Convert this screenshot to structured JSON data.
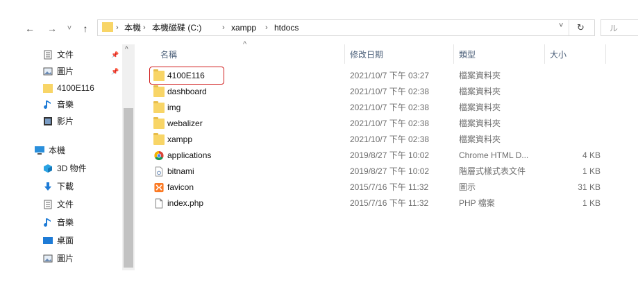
{
  "nav": {
    "back_glyph": "←",
    "forward_glyph": "→",
    "recent_glyph": "˅",
    "up_glyph": "↑",
    "dropdown_glyph": "˅",
    "refresh_glyph": "↻",
    "search_glyph": "ル"
  },
  "breadcrumb": [
    "本機",
    "本機磁碟 (C:)",
    "xampp",
    "htdocs"
  ],
  "breadcrumb_sep": "›",
  "sidebar": {
    "items": [
      {
        "label": "文件",
        "icon": "document-icon",
        "pinned": true
      },
      {
        "label": "圖片",
        "icon": "pictures-icon",
        "pinned": true
      },
      {
        "label": "4100E116",
        "icon": "folder-icon",
        "pinned": false
      },
      {
        "label": "音樂",
        "icon": "music-icon",
        "pinned": false
      },
      {
        "label": "影片",
        "icon": "video-icon",
        "pinned": false
      },
      {
        "label": "本機",
        "icon": "computer-icon",
        "pinned": false
      },
      {
        "label": "3D 物件",
        "icon": "3d-objects-icon",
        "pinned": false
      },
      {
        "label": "下載",
        "icon": "download-icon",
        "pinned": false
      },
      {
        "label": "文件",
        "icon": "document-icon",
        "pinned": false
      },
      {
        "label": "音樂",
        "icon": "music-icon",
        "pinned": false
      },
      {
        "label": "桌面",
        "icon": "desktop-icon",
        "pinned": false
      },
      {
        "label": "圖片",
        "icon": "pictures-icon",
        "pinned": false
      }
    ],
    "pin_glyph": "📌"
  },
  "columns": {
    "name": "名稱",
    "date": "修改日期",
    "type": "類型",
    "size": "大小",
    "sort_glyph": "^"
  },
  "files": [
    {
      "name": "4100E116",
      "date": "2021/10/7 下午 03:27",
      "type": "檔案資料夾",
      "size": "",
      "icon": "folder-icon"
    },
    {
      "name": "dashboard",
      "date": "2021/10/7 下午 02:38",
      "type": "檔案資料夾",
      "size": "",
      "icon": "folder-icon"
    },
    {
      "name": "img",
      "date": "2021/10/7 下午 02:38",
      "type": "檔案資料夾",
      "size": "",
      "icon": "folder-icon"
    },
    {
      "name": "webalizer",
      "date": "2021/10/7 下午 02:38",
      "type": "檔案資料夾",
      "size": "",
      "icon": "folder-icon"
    },
    {
      "name": "xampp",
      "date": "2021/10/7 下午 02:38",
      "type": "檔案資料夾",
      "size": "",
      "icon": "folder-icon"
    },
    {
      "name": "applications",
      "date": "2019/8/27 下午 10:02",
      "type": "Chrome HTML D...",
      "size": "4 KB",
      "icon": "chrome-icon"
    },
    {
      "name": "bitnami",
      "date": "2019/8/27 下午 10:02",
      "type": "階層式樣式表文件",
      "size": "1 KB",
      "icon": "css-file-icon"
    },
    {
      "name": "favicon",
      "date": "2015/7/16 下午 11:32",
      "type": "圖示",
      "size": "31 KB",
      "icon": "xampp-icon"
    },
    {
      "name": "index.php",
      "date": "2015/7/16 下午 11:32",
      "type": "PHP 檔案",
      "size": "1 KB",
      "icon": "blank-file-icon"
    }
  ],
  "colors": {
    "highlight": "#d01c1c",
    "folder": "#f8d567",
    "header_text": "#4c607a"
  }
}
